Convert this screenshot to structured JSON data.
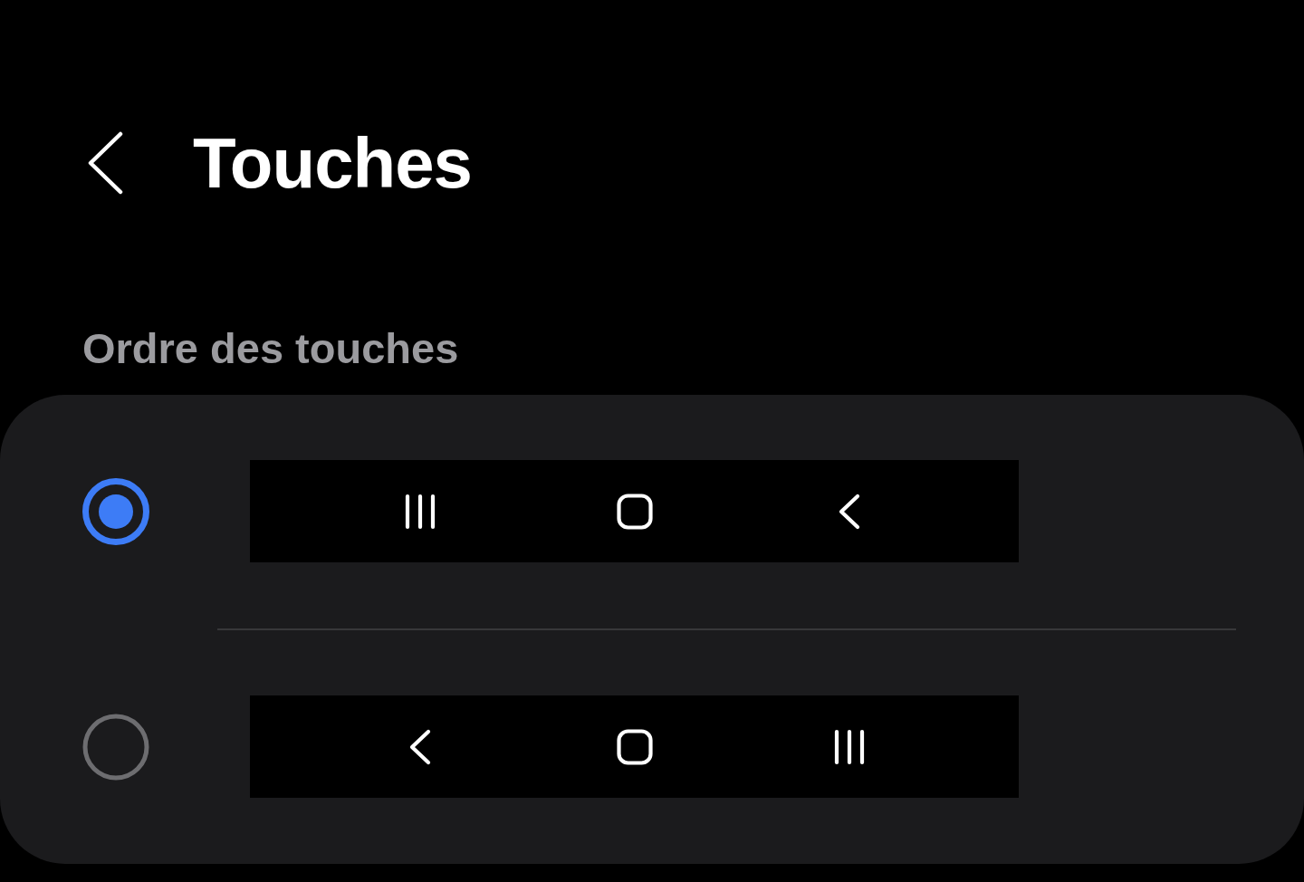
{
  "header": {
    "title": "Touches"
  },
  "section": {
    "label": "Ordre des touches"
  },
  "options": [
    {
      "selected": true,
      "keys": [
        {
          "kind": "recents"
        },
        {
          "kind": "home"
        },
        {
          "kind": "back"
        }
      ]
    },
    {
      "selected": false,
      "keys": [
        {
          "kind": "back"
        },
        {
          "kind": "home"
        },
        {
          "kind": "recents"
        }
      ]
    }
  ]
}
